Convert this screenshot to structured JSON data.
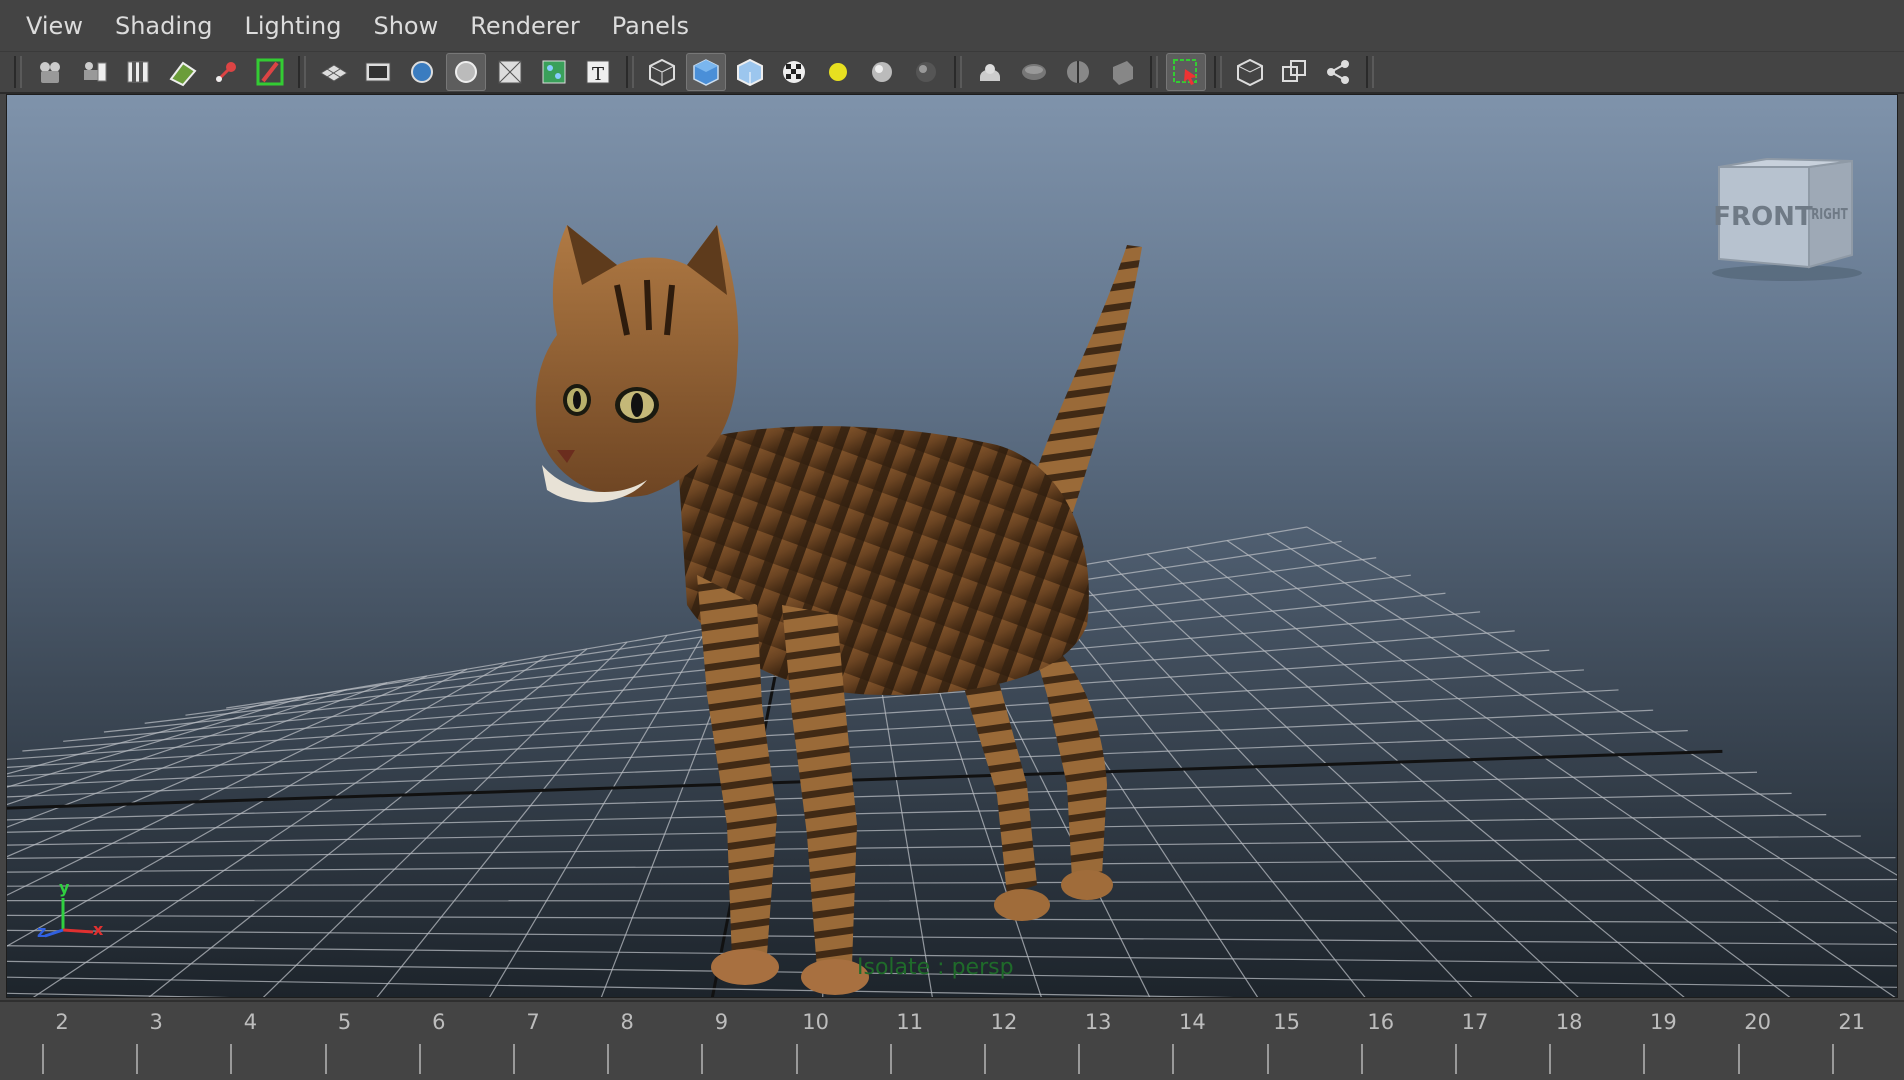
{
  "menu": {
    "items": [
      {
        "label": "View"
      },
      {
        "label": "Shading"
      },
      {
        "label": "Lighting"
      },
      {
        "label": "Show"
      },
      {
        "label": "Renderer"
      },
      {
        "label": "Panels"
      }
    ]
  },
  "toolbar": {
    "groups": [
      [
        "select-camera-icon",
        "camera-attributes-icon",
        "bookmarks-icon",
        "image-plane-icon",
        "2d-pan-zoom-icon",
        "grease-pencil-icon"
      ],
      [
        "grid-icon",
        "film-gate-icon",
        "resolution-gate-icon",
        "gate-mask-icon",
        "field-chart-icon",
        "safe-action-icon",
        "safe-title-icon"
      ],
      [
        "wireframe-icon",
        "smooth-shade-icon",
        "wireframe-on-shaded-icon",
        "textured-icon",
        "use-all-lights-icon",
        "shadows-icon",
        "screen-space-ao-icon"
      ],
      [
        "motion-blur-icon",
        "multisample-aa-icon",
        "depth-of-field-icon",
        "xray-icon"
      ],
      [
        "isolate-select-icon"
      ],
      [
        "xray-joints-icon",
        "xray-active-components-icon",
        "node-editor-icon"
      ]
    ],
    "active": [
      "smooth-shade-icon",
      "gate-mask-icon",
      "isolate-select-icon"
    ]
  },
  "viewport": {
    "viewcube": {
      "front_label": "FRONT",
      "right_label": "RIGHT"
    },
    "isolate_label": "Isolate : persp",
    "axis": {
      "y": "y",
      "z": "z",
      "x": "x"
    },
    "colors": {
      "x_axis": "#e03030",
      "y_axis": "#30d040",
      "z_axis": "#3060e0",
      "isolate_text": "#1f6b2a"
    }
  },
  "timeline": {
    "frames": [
      "2",
      "3",
      "4",
      "5",
      "6",
      "7",
      "8",
      "9",
      "10",
      "11",
      "12",
      "13",
      "14",
      "15",
      "16",
      "17",
      "18",
      "19",
      "20",
      "21"
    ]
  }
}
